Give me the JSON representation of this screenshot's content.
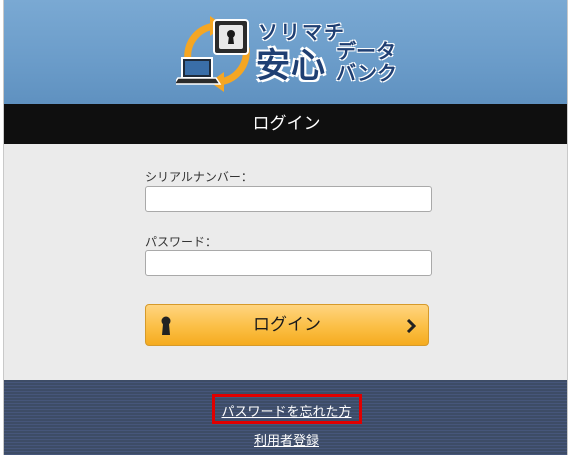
{
  "header": {
    "logo_line1": "ソリマチ",
    "logo_line2": "安心",
    "logo_line3a": "データ",
    "logo_line3b": "バンク",
    "logo_icon": "laptop-safe-sync-icon"
  },
  "title": "ログイン",
  "form": {
    "serial_label": "シリアルナンバー：",
    "serial_value": "",
    "password_label": "パスワード：",
    "password_value": "",
    "login_button_label": "ログイン",
    "login_button_icon": "keyhole-icon",
    "login_button_arrow": "chevron-right-icon"
  },
  "footer": {
    "forgot_password": "パスワードを忘れた方",
    "register": "利用者登録"
  },
  "colors": {
    "banner": "#6c9dca",
    "title_bar": "#0f0f0f",
    "form_bg": "#ebebeb",
    "button": "#fbbf45",
    "footer": "#3d4c66",
    "highlight": "#e00000"
  }
}
